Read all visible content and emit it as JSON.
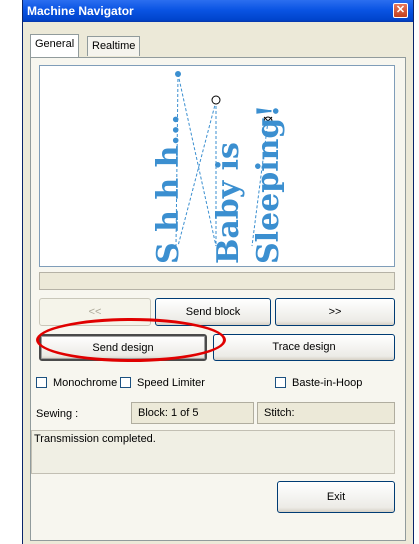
{
  "window": {
    "title": "Machine Navigator",
    "close_glyph": "✕"
  },
  "tabs": [
    {
      "label": "General"
    },
    {
      "label": "Realtime"
    }
  ],
  "preview": {
    "design_lines": [
      "S h h h...",
      "Baby is",
      "Sleeping!"
    ],
    "design_color": "#3b8fd0"
  },
  "buttons": {
    "prev": "<<",
    "send_block": "Send block",
    "next": ">>",
    "send_design": "Send design",
    "trace_design": "Trace design",
    "exit": "Exit"
  },
  "checkboxes": [
    {
      "label": "Monochrome",
      "checked": false
    },
    {
      "label": "Speed Limiter",
      "checked": false
    },
    {
      "label": "Baste-in-Hoop",
      "checked": false
    }
  ],
  "status": {
    "sewing_label": "Sewing :",
    "block": "Block: 1 of 5",
    "stitch": "Stitch:",
    "message": "Transmission completed."
  },
  "annotation": {
    "highlight_color": "#e00000"
  }
}
